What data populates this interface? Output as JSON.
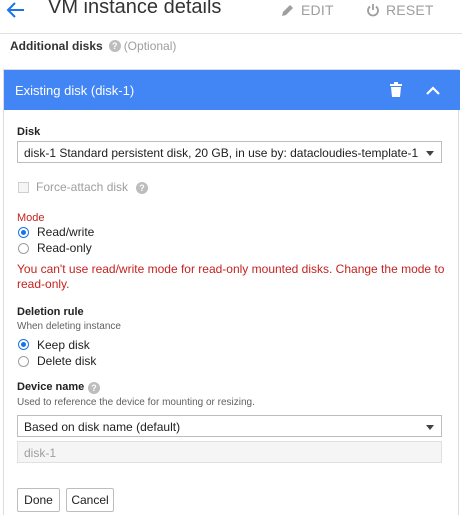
{
  "header": {
    "title": "VM instance details",
    "edit_label": "EDIT",
    "reset_label": "RESET"
  },
  "section": {
    "label": "Additional disks",
    "help_glyph": "?",
    "optional": "(Optional)"
  },
  "panel": {
    "title": "Existing disk (disk-1)",
    "accent_color": "#4285f4"
  },
  "disk": {
    "label": "Disk",
    "selected": "disk-1 Standard persistent disk, 20 GB, in use by: datacloudies-template-1"
  },
  "force_attach": {
    "label": "Force-attach disk",
    "checked": false
  },
  "mode": {
    "label": "Mode",
    "options": [
      "Read/write",
      "Read-only"
    ],
    "selected": "Read/write",
    "error": "You can't use read/write mode for read-only mounted disks. Change the mode to read-only.",
    "error_color": "#c5221f"
  },
  "deletion_rule": {
    "label": "Deletion rule",
    "sub": "When deleting instance",
    "options": [
      "Keep disk",
      "Delete disk"
    ],
    "selected": "Keep disk"
  },
  "device_name": {
    "label": "Device name",
    "sub": "Used to reference the device for mounting or resizing.",
    "selected": "Based on disk name (default)",
    "value": "disk-1"
  },
  "actions": {
    "done": "Done",
    "cancel": "Cancel"
  }
}
